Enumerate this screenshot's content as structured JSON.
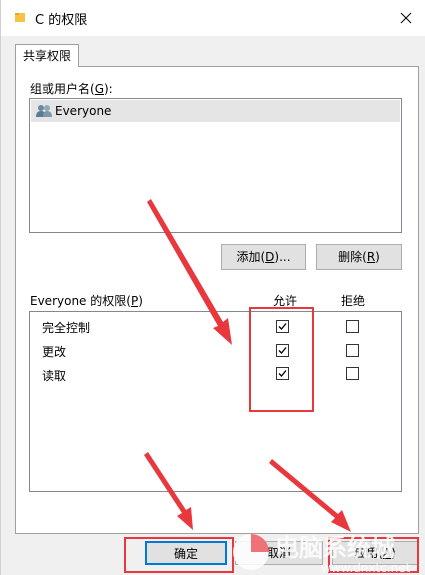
{
  "window": {
    "title": "C 的权限",
    "close_glyph": "✕",
    "folder_icon": "folder-icon",
    "accent": "#1a73e8"
  },
  "tabs": [
    {
      "label": "共享权限",
      "active": true
    }
  ],
  "groups": {
    "label": "组或用户名(G):",
    "label_pre": "组或用户名(",
    "label_key": "G",
    "label_post": "):",
    "items": [
      {
        "name": "Everyone",
        "icon": "users-icon",
        "selected": true
      }
    ]
  },
  "buttons": {
    "add_pre": "添加(",
    "add_key": "D",
    "add_post": ")...",
    "remove_pre": "删除(",
    "remove_key": "R",
    "remove_post": ")",
    "ok": "确定",
    "cancel": "取消",
    "apply_pre": "应用(",
    "apply_key": "A",
    "apply_post": ")"
  },
  "permissions": {
    "label_pre": "Everyone 的权限(",
    "label_key": "P",
    "label_post": ")",
    "allow_header": "允许",
    "deny_header": "拒绝",
    "rows": [
      {
        "name": "完全控制",
        "allow": true,
        "deny": false
      },
      {
        "name": "更改",
        "allow": true,
        "deny": false
      },
      {
        "name": "读取",
        "allow": true,
        "deny": false
      }
    ]
  },
  "annotation_color": "#e8383d",
  "watermark": {
    "text_top": "电脑系统城",
    "text_bottom": "www.dnxtc.net"
  }
}
